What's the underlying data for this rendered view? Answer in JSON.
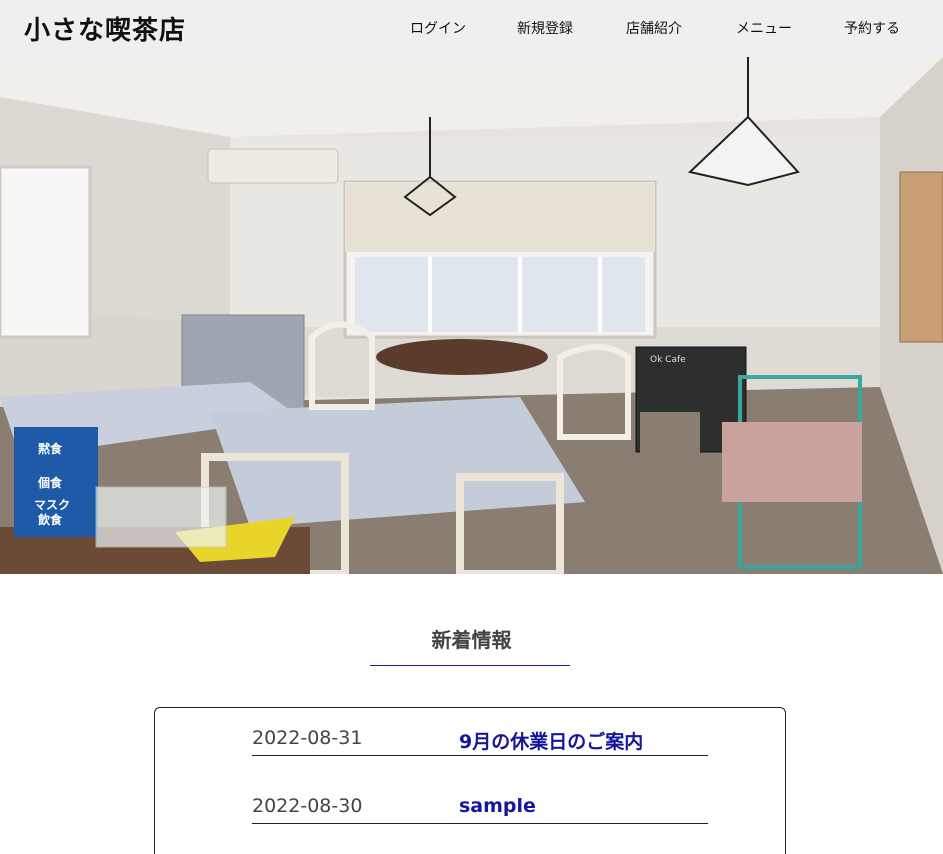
{
  "header": {
    "logo": "小さな喫茶店",
    "nav": [
      "ログイン",
      "新規登録",
      "店舗紹介",
      "メニュー",
      "予約する"
    ]
  },
  "hero": {
    "signs": {
      "board_title": "Ok Cafe",
      "sign_line1": "黙食",
      "sign_line2": "個食",
      "sign_line3": "マスク",
      "sign_line4": "飲食"
    }
  },
  "news": {
    "heading": "新着情報",
    "items": [
      {
        "date": "2022-08-31",
        "title": "9月の休業日のご案内"
      },
      {
        "date": "2022-08-30",
        "title": "sample"
      }
    ]
  },
  "colors": {
    "header_bg": "#efefef",
    "link_blue": "#16169a",
    "rule_blue": "#1a1aa8"
  }
}
